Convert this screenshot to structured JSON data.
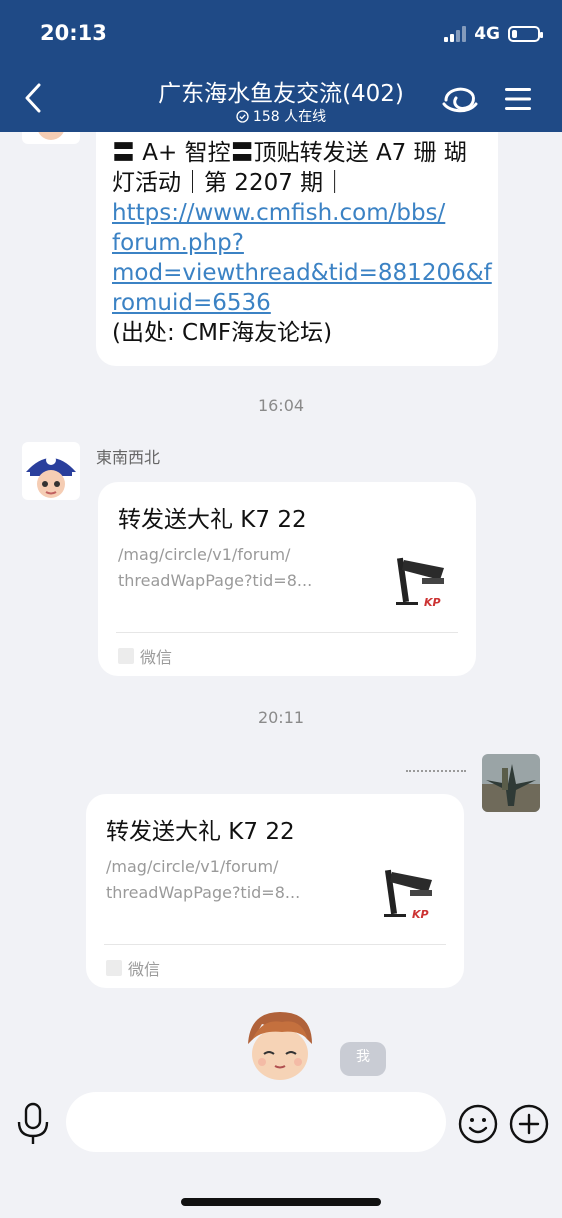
{
  "status_bar": {
    "time": "20:13",
    "network": "4G"
  },
  "header": {
    "title": "广东海水鱼友交流(402)",
    "online": "158 人在线"
  },
  "messages": {
    "first": {
      "line1": "〓 A+ 智控〓顶贴转发送 A7 珊 瑚",
      "line2": "灯活动｜第 2207 期｜",
      "link_lines": [
        "https://www.cmfish.com/bbs/",
        "forum.php?",
        "mod=viewthread&tid=881206&f",
        "romuid=6536"
      ],
      "source": "(出处: CMF海友论坛)"
    },
    "time_1": "16:04",
    "second": {
      "sender": "東南西北",
      "title": "转发送大礼 K7 22",
      "desc_line1": "/mag/circle/v1/forum/",
      "desc_line2": "threadWapPage?tid=8...",
      "source": "微信",
      "thumb_brand": "KP"
    },
    "time_2": "20:11",
    "third": {
      "title": "转发送大礼 K7 22",
      "desc_line1": "/mag/circle/v1/forum/",
      "desc_line2": "threadWapPage?tid=8...",
      "source": "微信",
      "thumb_brand": "KP"
    },
    "me_label": "我"
  },
  "colors": {
    "header_bg": "#1f4a86",
    "chat_bg": "#f1f2f6",
    "link": "#3b82c4"
  }
}
